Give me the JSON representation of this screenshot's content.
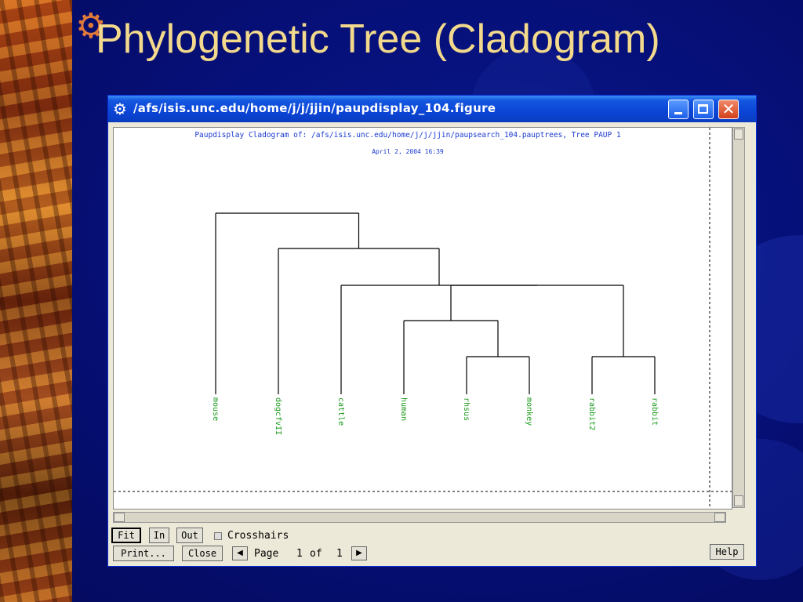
{
  "slide": {
    "title": "Phylogenetic Tree (Cladogram)"
  },
  "window": {
    "title": "/afs/isis.unc.edu/home/j/j/jjin/paupdisplay_104.figure",
    "icon": "gear-icon",
    "controls": [
      "minimize-icon",
      "maximize-icon",
      "close-icon"
    ]
  },
  "figure": {
    "header": "Paupdisplay Cladogram of: /afs/isis.unc.edu/home/j/j/jjin/paupsearch_104.pauptrees, Tree PAUP 1",
    "date": "April 2, 2004 16:39",
    "line_color": "#000000",
    "label_color": "#1a9a1a",
    "header_color": "#1a3ad0",
    "taxa": [
      "mouse",
      "dogcfvII",
      "cattle",
      "human",
      "rhsus",
      "monkey",
      "rabbit2",
      "rabbit"
    ]
  },
  "toolbar": {
    "fit_label": "Fit",
    "in_label": "In",
    "out_label": "Out",
    "crosshairs_label": "Crosshairs",
    "print_label": "Print...",
    "close_label": "Close",
    "help_label": "Help",
    "page_label": "Page",
    "page_current": "1",
    "of_label": "of",
    "page_total": "1"
  }
}
